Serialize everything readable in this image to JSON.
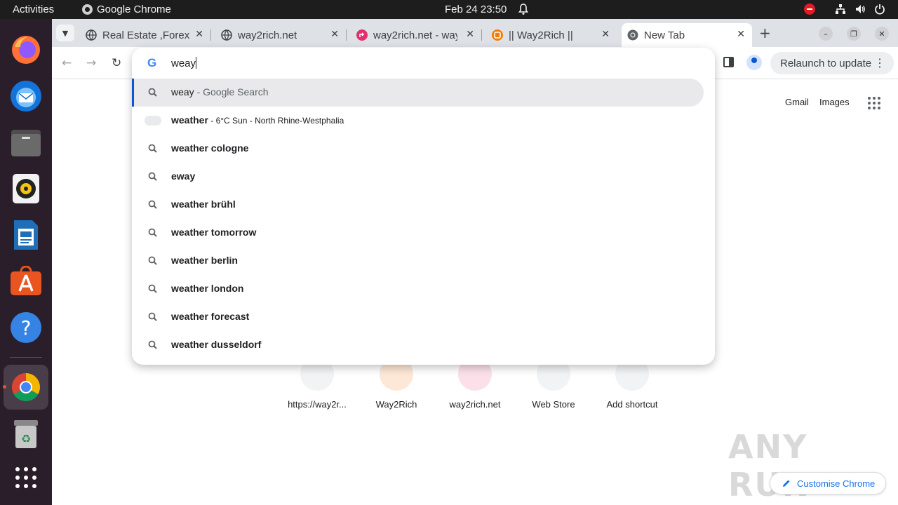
{
  "topbar": {
    "activities": "Activities",
    "app_name": "Google Chrome",
    "clock": "Feb 24  23:50"
  },
  "tabs": [
    {
      "title": "Real Estate ,Forex",
      "favicon": "globe-icon"
    },
    {
      "title": "way2rich.net",
      "favicon": "globe-icon"
    },
    {
      "title": "way2rich.net - way",
      "favicon": "pink-redirect-icon"
    },
    {
      "title": "|| Way2Rich ||",
      "favicon": "blogger-icon"
    },
    {
      "title": "New Tab",
      "favicon": "chrome-icon",
      "active": true
    }
  ],
  "toolbar": {
    "relaunch_label": "Relaunch to update"
  },
  "omnibox": {
    "input_value": "weay",
    "suggestions": [
      {
        "main": "weay",
        "sub": " - Google Search",
        "icon": "search-icon",
        "selected": true
      },
      {
        "main": "weather",
        "small": " - 6°C Sun - North Rhine-Westphalia",
        "icon": "weather-cloud-icon"
      },
      {
        "main": "weather cologne",
        "icon": "search-icon"
      },
      {
        "main": "eway",
        "icon": "search-icon"
      },
      {
        "main": "weather brühl",
        "icon": "search-icon"
      },
      {
        "main": "weather tomorrow",
        "icon": "search-icon"
      },
      {
        "main": "weather berlin",
        "icon": "search-icon"
      },
      {
        "main": "weather london",
        "icon": "search-icon"
      },
      {
        "main": "weather forecast",
        "icon": "search-icon"
      },
      {
        "main": "weather dusseldorf",
        "icon": "search-icon"
      }
    ]
  },
  "ntp": {
    "gmail": "Gmail",
    "images": "Images",
    "shortcuts": [
      {
        "label": "https://way2r..."
      },
      {
        "label": "Way2Rich"
      },
      {
        "label": "way2rich.net"
      },
      {
        "label": "Web Store"
      },
      {
        "label": "Add shortcut"
      }
    ],
    "customise": "Customise Chrome",
    "watermark": "ANY RUN"
  },
  "dock": {
    "apps": [
      "firefox-icon",
      "thunderbird-icon",
      "files-icon",
      "rhythmbox-icon",
      "writer-icon",
      "app-center-icon",
      "help-icon",
      "chrome-icon",
      "trash-icon",
      "show-apps-icon"
    ]
  },
  "colors": {
    "accent": "#0b57d0",
    "ubuntu_orange": "#e95420"
  }
}
